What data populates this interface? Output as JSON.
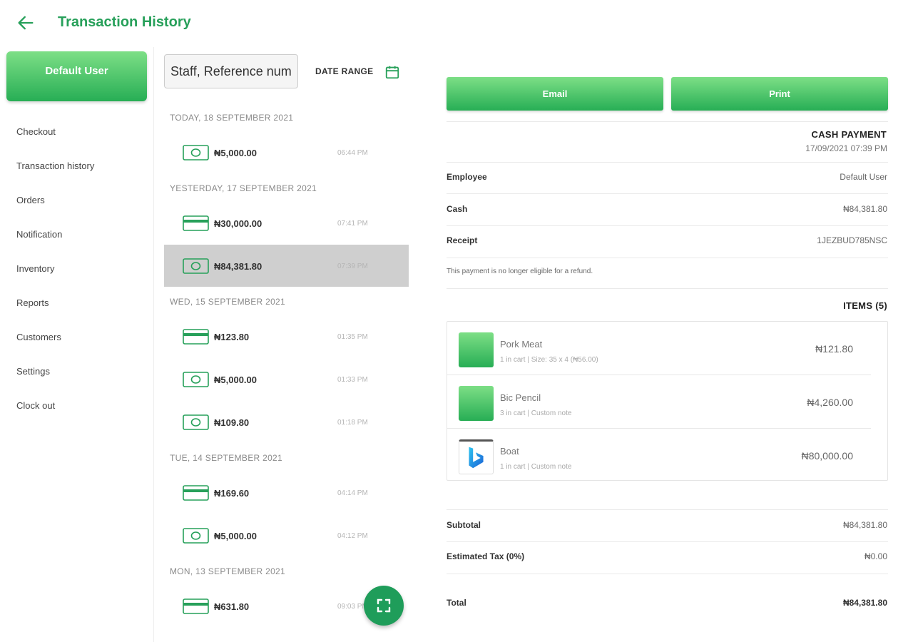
{
  "header": {
    "title": "Transaction History"
  },
  "sidebar": {
    "user_button": "Default User",
    "items": [
      {
        "label": "Checkout"
      },
      {
        "label": "Transaction history"
      },
      {
        "label": "Orders"
      },
      {
        "label": "Notification"
      },
      {
        "label": "Inventory"
      },
      {
        "label": "Reports"
      },
      {
        "label": "Customers"
      },
      {
        "label": "Settings"
      },
      {
        "label": "Clock out"
      }
    ]
  },
  "filters": {
    "search_value": "Staff, Reference number",
    "date_range_label": "DATE RANGE"
  },
  "transactions": {
    "groups": [
      {
        "date": "TODAY, 18 SEPTEMBER 2021",
        "rows": [
          {
            "icon": "cash",
            "amount": "₦5,000.00",
            "time": "06:44 PM"
          }
        ]
      },
      {
        "date": "YESTERDAY, 17 SEPTEMBER 2021",
        "rows": [
          {
            "icon": "card",
            "amount": "₦30,000.00",
            "time": "07:41 PM"
          },
          {
            "icon": "cash",
            "amount": "₦84,381.80",
            "time": "07:39 PM",
            "selected": true
          }
        ]
      },
      {
        "date": "WED, 15 SEPTEMBER 2021",
        "rows": [
          {
            "icon": "card",
            "amount": "₦123.80",
            "time": "01:35 PM"
          },
          {
            "icon": "cash",
            "amount": "₦5,000.00",
            "time": "01:33 PM"
          },
          {
            "icon": "cash",
            "amount": "₦109.80",
            "time": "01:18 PM"
          }
        ]
      },
      {
        "date": "TUE, 14 SEPTEMBER 2021",
        "rows": [
          {
            "icon": "card",
            "amount": "₦169.60",
            "time": "04:14 PM"
          },
          {
            "icon": "cash",
            "amount": "₦5,000.00",
            "time": "04:12 PM"
          }
        ]
      },
      {
        "date": "MON, 13 SEPTEMBER 2021",
        "rows": [
          {
            "icon": "card",
            "amount": "₦631.80",
            "time": "09:03 PM"
          }
        ]
      }
    ]
  },
  "detail": {
    "email_button": "Email",
    "print_button": "Print",
    "payment_type": "CASH PAYMENT",
    "payment_datetime": "17/09/2021 07:39 PM",
    "employee_label": "Employee",
    "employee_value": "Default User",
    "cash_label": "Cash",
    "cash_value": "₦84,381.80",
    "receipt_label": "Receipt",
    "receipt_value": "1JEZBUD785NSC",
    "refund_note": "This payment is no longer eligible for a refund.",
    "items_title": "ITEMS (5)",
    "items": [
      {
        "name": "Pork Meat",
        "meta": "1 in cart  |  Size: 35 x 4 (₦56.00)",
        "price": "₦121.80",
        "thumb": "green-gradient"
      },
      {
        "name": "Bic Pencil",
        "meta": "3 in cart  |  Custom note",
        "price": "₦4,260.00",
        "thumb": "green-gradient"
      },
      {
        "name": "Boat",
        "meta": "1 in cart  |  Custom note",
        "price": "₦80,000.00",
        "thumb": "bing-logo"
      }
    ],
    "subtotal_label": "Subtotal",
    "subtotal_value": "₦84,381.80",
    "tax_label": "Estimated Tax (0%)",
    "tax_value": "₦0.00",
    "total_label": "Total",
    "total_value": "₦84,381.80"
  },
  "colors": {
    "accent": "#27a05a",
    "gradient_top": "#7ddf86",
    "gradient_bottom": "#27ae55",
    "selected_row": "#cfcfcf"
  }
}
